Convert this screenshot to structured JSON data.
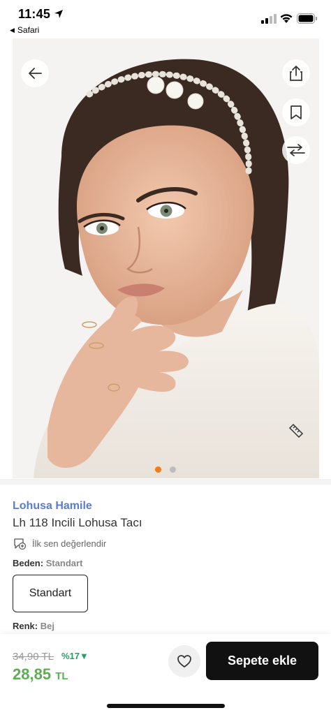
{
  "status": {
    "time": "11:45",
    "back_app": "Safari"
  },
  "gallery": {
    "image_desc_icon": "product-photo",
    "page_count": 2,
    "active_page": 1
  },
  "product": {
    "brand": "Lohusa Hamile",
    "name": "Lh 118 Incili Lohusa Tacı",
    "review_prompt": "İlk sen değerlendir",
    "size_label": "Beden:",
    "size_value": "Standart",
    "size_option": "Standart",
    "color_label": "Renk:",
    "color_value": "Bej"
  },
  "pricing": {
    "old_price": "34,90 TL",
    "discount": "%17▼",
    "price": "28,85",
    "currency": "TL"
  },
  "actions": {
    "add_to_cart": "Sepete ekle"
  },
  "colors": {
    "accent": "#f27a1a",
    "brand": "#5b7ad1",
    "price": "#5cae54",
    "discount": "#1fa365"
  }
}
